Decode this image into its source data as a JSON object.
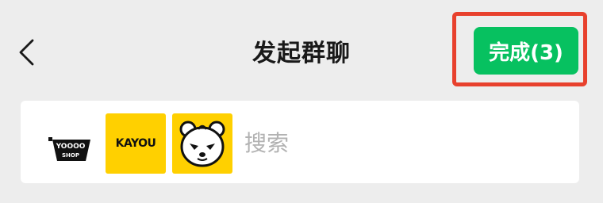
{
  "nav": {
    "back_icon": "chevron-left-icon",
    "title": "发起群聊",
    "done_label": "完成(3)"
  },
  "colors": {
    "background": "#ededed",
    "primary_green": "#07c160",
    "highlight_red": "#e8412d",
    "avatar_yellow": "#ffd000",
    "placeholder_gray": "#b2b2b2"
  },
  "selected_members": [
    {
      "name": "yoooo-shop",
      "logo_text_top": "YOOOO",
      "logo_text_bottom": "SHOP"
    },
    {
      "name": "kayou",
      "logo_text": "KAYOU"
    },
    {
      "name": "bear",
      "icon": "bear-face-icon"
    }
  ],
  "search": {
    "placeholder": "搜索",
    "value": ""
  }
}
